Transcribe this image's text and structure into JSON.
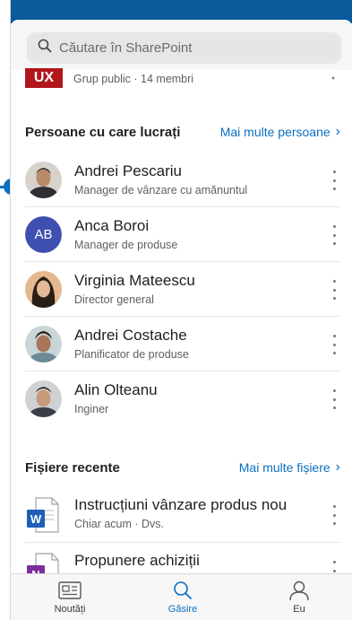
{
  "search": {
    "placeholder": "Căutare în SharePoint"
  },
  "site_row": {
    "logo_text": "UX",
    "subtitle": "Grup public · 14 membri"
  },
  "people_section": {
    "title": "Persoane cu care lucrați",
    "more_link": "Mai multe persoane",
    "people": [
      {
        "name": "Andrei Pescariu",
        "role": "Manager de vânzare cu amănuntul",
        "avatar": "photo"
      },
      {
        "name": "Anca Boroi",
        "role": "Manager de produse",
        "avatar": "initials",
        "initials": "AB"
      },
      {
        "name": "Virginia Mateescu",
        "role": "Director general",
        "avatar": "photo"
      },
      {
        "name": "Andrei Costache",
        "role": "Planificator de produse",
        "avatar": "photo"
      },
      {
        "name": "Alin Olteanu",
        "role": "Inginer",
        "avatar": "photo"
      }
    ]
  },
  "files_section": {
    "title": "Fișiere recente",
    "more_link": "Mai multe fișiere",
    "files": [
      {
        "name": "Instrucțiuni vânzare produs nou",
        "meta": "Chiar acum · Dvs.",
        "icon": "word-doc-icon"
      },
      {
        "name": "Propunere achiziții",
        "meta": "",
        "icon": "onenote-icon"
      }
    ]
  },
  "tabs": [
    {
      "label": "Noutăți",
      "icon": "news-icon",
      "active": false
    },
    {
      "label": "Găsire",
      "icon": "search-icon",
      "active": true
    },
    {
      "label": "Eu",
      "icon": "person-icon",
      "active": false
    }
  ],
  "colors": {
    "accent": "#0b6fc2",
    "topbar": "#0a5a9c",
    "ux_logo": "#b2161b",
    "initials_avatar": "#3f4fb0"
  }
}
